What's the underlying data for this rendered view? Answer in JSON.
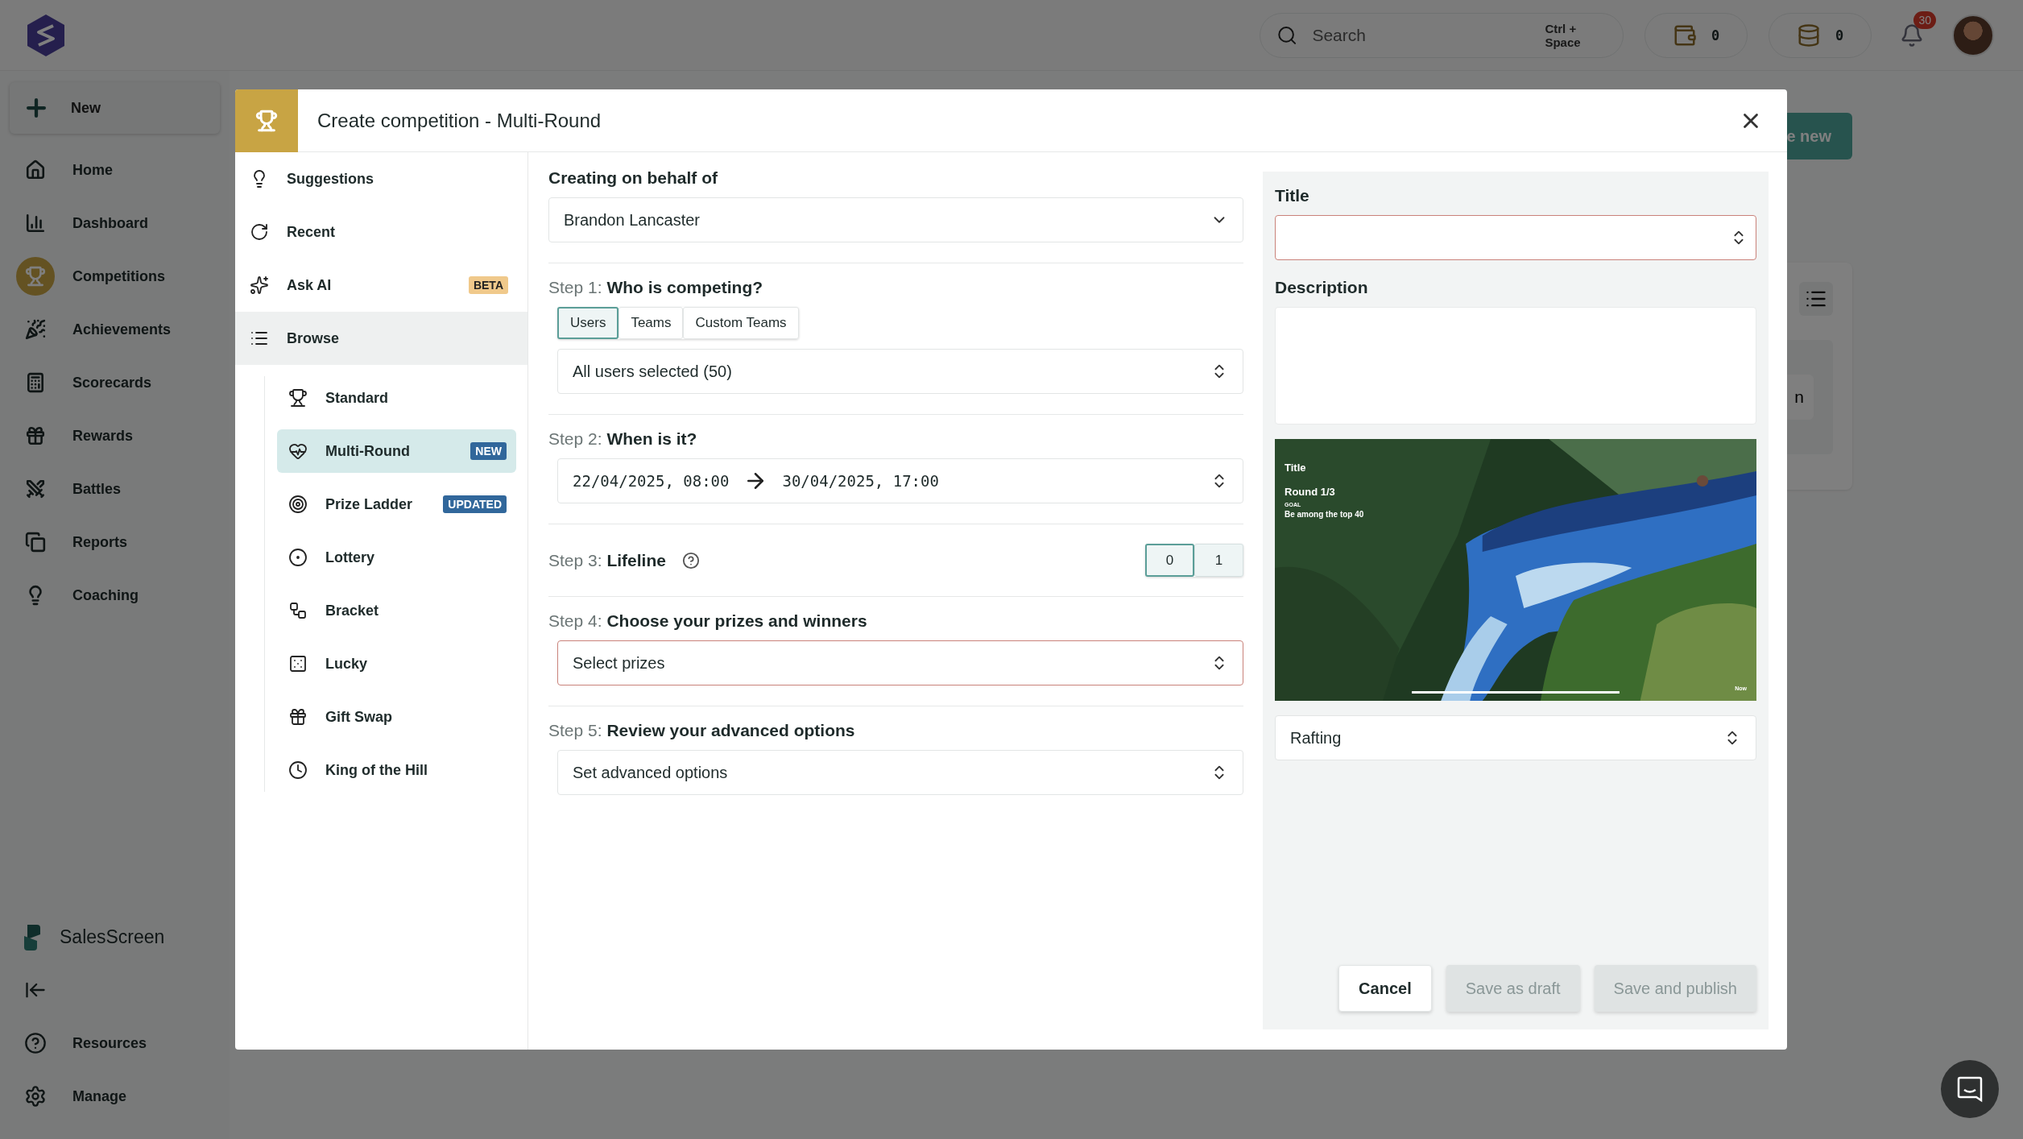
{
  "topbar": {
    "search": {
      "placeholder": "Search",
      "shortcut": "Ctrl + Space"
    },
    "wallet": "0",
    "coins": "0",
    "notifications": "30"
  },
  "sidebar": {
    "new_button": "New",
    "items": [
      {
        "label": "Home",
        "selected": false
      },
      {
        "label": "Dashboard",
        "selected": false
      },
      {
        "label": "Competitions",
        "selected": true
      },
      {
        "label": "Achievements",
        "selected": false
      },
      {
        "label": "Scorecards",
        "selected": false
      },
      {
        "label": "Rewards",
        "selected": false
      },
      {
        "label": "Battles",
        "selected": false
      },
      {
        "label": "Reports",
        "selected": false
      },
      {
        "label": "Coaching",
        "selected": false
      }
    ],
    "brand": "SalesScreen",
    "footer": [
      "Resources",
      "Manage"
    ]
  },
  "background": {
    "create_button": "e new",
    "card_button": "n"
  },
  "modal": {
    "title": "Create competition - Multi-Round",
    "nav": [
      {
        "label": "Suggestions",
        "selected": false
      },
      {
        "label": "Recent",
        "selected": false
      },
      {
        "label": "Ask AI",
        "selected": false,
        "badge": {
          "text": "BETA",
          "color": "#f0c98b"
        }
      },
      {
        "label": "Browse",
        "selected": true,
        "children": [
          {
            "label": "Standard",
            "selected": false
          },
          {
            "label": "Multi-Round",
            "selected": true,
            "badge": {
              "text": "NEW",
              "color": "#31679b"
            }
          },
          {
            "label": "Prize Ladder",
            "selected": false,
            "badge": {
              "text": "UPDATED",
              "color": "#31679b"
            }
          },
          {
            "label": "Lottery",
            "selected": false
          },
          {
            "label": "Bracket",
            "selected": false
          },
          {
            "label": "Lucky",
            "selected": false
          },
          {
            "label": "Gift Swap",
            "selected": false
          },
          {
            "label": "King of the Hill",
            "selected": false
          }
        ]
      }
    ],
    "form": {
      "behalf": {
        "label": "Creating on behalf of",
        "value": "Brandon Lancaster"
      },
      "steps": [
        {
          "kind": "segmented",
          "step": "Step 1:",
          "title": "Who is competing?",
          "options": [
            {
              "label": "Users",
              "selected": true
            },
            {
              "label": "Teams",
              "selected": false
            },
            {
              "label": "Custom Teams",
              "selected": false
            }
          ],
          "value": "All users selected (50)"
        },
        {
          "kind": "daterange",
          "step": "Step 2:",
          "title": "When is it?",
          "start": "22/04/2025, 08:00",
          "end": "30/04/2025, 17:00"
        },
        {
          "kind": "toggle",
          "step": "Step 3:",
          "title": "Lifeline",
          "help": true,
          "options": [
            {
              "label": "0",
              "selected": true
            },
            {
              "label": "1",
              "selected": false
            }
          ]
        },
        {
          "kind": "select",
          "step": "Step 4:",
          "title": "Choose your prizes and winners",
          "value": "Select prizes",
          "invalid": true
        },
        {
          "kind": "select",
          "step": "Step 5:",
          "title": "Review your advanced options",
          "value": "Set advanced options",
          "invalid": false
        }
      ]
    },
    "details": {
      "title_label": "Title",
      "title_invalid": true,
      "description_label": "Description",
      "preview": {
        "title": "Title",
        "round": "Round 1/3",
        "goal_label": "GOAL",
        "goal": "Be among the top 40",
        "now": "Now"
      },
      "theme": "Rafting"
    },
    "buttons": [
      {
        "label": "Cancel",
        "disabled": false
      },
      {
        "label": "Save as draft",
        "disabled": true
      },
      {
        "label": "Save and publish",
        "disabled": true
      }
    ]
  }
}
